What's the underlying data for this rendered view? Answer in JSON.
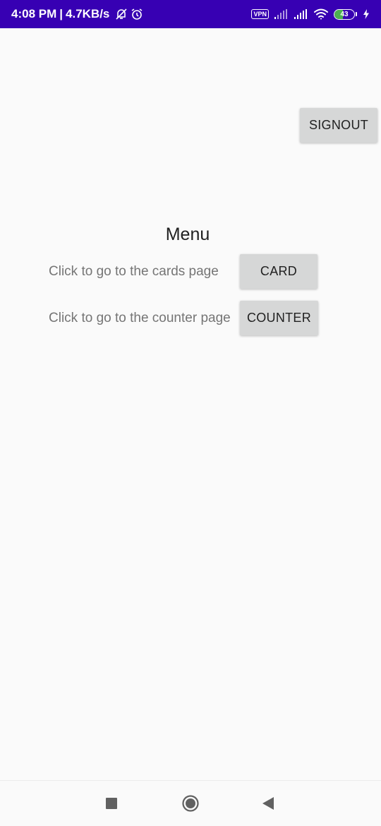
{
  "status_bar": {
    "time": "4:08 PM",
    "separator": "|",
    "speed": "4.7KB/s",
    "vpn": "VPN",
    "battery_level": "43",
    "battery_fraction": 0.43,
    "background_color": "#3700b3",
    "icons": [
      "mute-notifications-icon",
      "alarm-icon",
      "cellular-signal-icon",
      "cellular-signal-icon",
      "wifi-icon",
      "battery-icon",
      "charging-bolt-icon"
    ]
  },
  "header": {
    "signout_label": "SIGNOUT"
  },
  "menu": {
    "title": "Menu",
    "rows": [
      {
        "label": "Click to go to the cards page",
        "button": "CARD"
      },
      {
        "label": "Click to go to the counter page",
        "button": "COUNTER"
      }
    ]
  },
  "nav_bar": {
    "icons": [
      "recents-square-icon",
      "home-circle-icon",
      "back-triangle-icon"
    ]
  },
  "colors": {
    "accent": "#3700b3",
    "button_bg": "#d6d7d7",
    "background": "#fafafa",
    "secondary_text": "#757575"
  }
}
